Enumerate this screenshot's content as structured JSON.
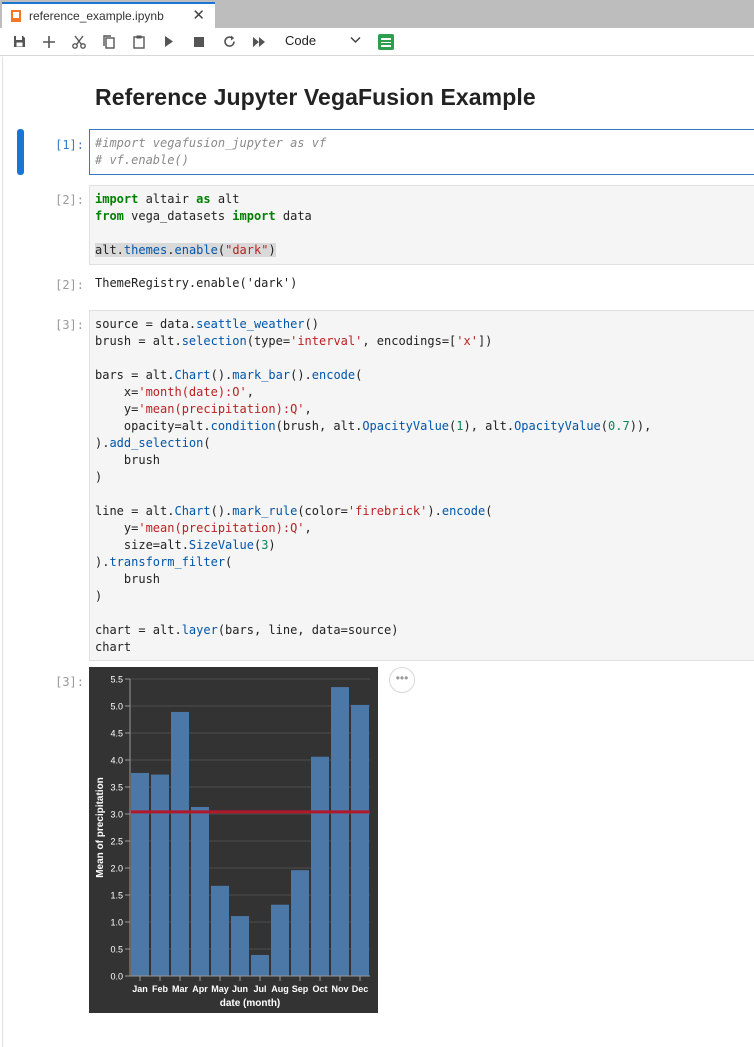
{
  "tab": {
    "title": "reference_example.ipynb",
    "close": "✕"
  },
  "toolbar": {
    "icons": [
      "save-icon",
      "add-icon",
      "cut-icon",
      "copy-icon",
      "paste-icon",
      "run-icon",
      "stop-icon",
      "restart-icon",
      "fast-forward-icon"
    ],
    "cell_type": "Code"
  },
  "notebook": {
    "title": "Reference Jupyter VegaFusion Example",
    "cells": [
      {
        "prompt": "[1]:",
        "code": "#import vegafusion_jupyter as vf\n# vf.enable()"
      },
      {
        "prompt": "[2]:",
        "code": "import altair as alt\nfrom vega_datasets import data\n\nalt.themes.enable(\"dark\")"
      },
      {
        "prompt": "[2]:",
        "output": "ThemeRegistry.enable('dark')"
      },
      {
        "prompt": "[3]:",
        "code": "source = data.seattle_weather()\nbrush = alt.selection(type='interval', encodings=['x'])\n\nbars = alt.Chart().mark_bar().encode(\n    x='month(date):O',\n    y='mean(precipitation):Q',\n    opacity=alt.condition(brush, alt.OpacityValue(1), alt.OpacityValue(0.7)),\n).add_selection(\n    brush\n)\n\nline = alt.Chart().mark_rule(color='firebrick').encode(\n    y='mean(precipitation):Q',\n    size=alt.SizeValue(3)\n).transform_filter(\n    brush\n)\n\nchart = alt.layer(bars, line, data=source)\nchart"
      },
      {
        "prompt": "[3]:"
      }
    ],
    "more_button": "•••"
  },
  "chart_data": {
    "type": "bar",
    "categories": [
      "Jan",
      "Feb",
      "Mar",
      "Apr",
      "May",
      "Jun",
      "Jul",
      "Aug",
      "Sep",
      "Oct",
      "Nov",
      "Dec"
    ],
    "values": [
      3.76,
      3.73,
      4.89,
      3.13,
      1.67,
      1.11,
      0.39,
      1.32,
      1.96,
      4.06,
      5.35,
      5.02
    ],
    "rule_value": 3.04,
    "xlabel": "date (month)",
    "ylabel": "Mean of precipitation",
    "ylim": [
      0,
      5.5
    ],
    "yticks": [
      "0.0",
      "0.5",
      "1.0",
      "1.5",
      "2.0",
      "2.5",
      "3.0",
      "3.5",
      "4.0",
      "4.5",
      "5.0",
      "5.5"
    ],
    "grid": true,
    "colors": {
      "bar": "#4c78a8",
      "rule": "#b2182b",
      "background": "#333333",
      "text": "#ffffff"
    }
  }
}
